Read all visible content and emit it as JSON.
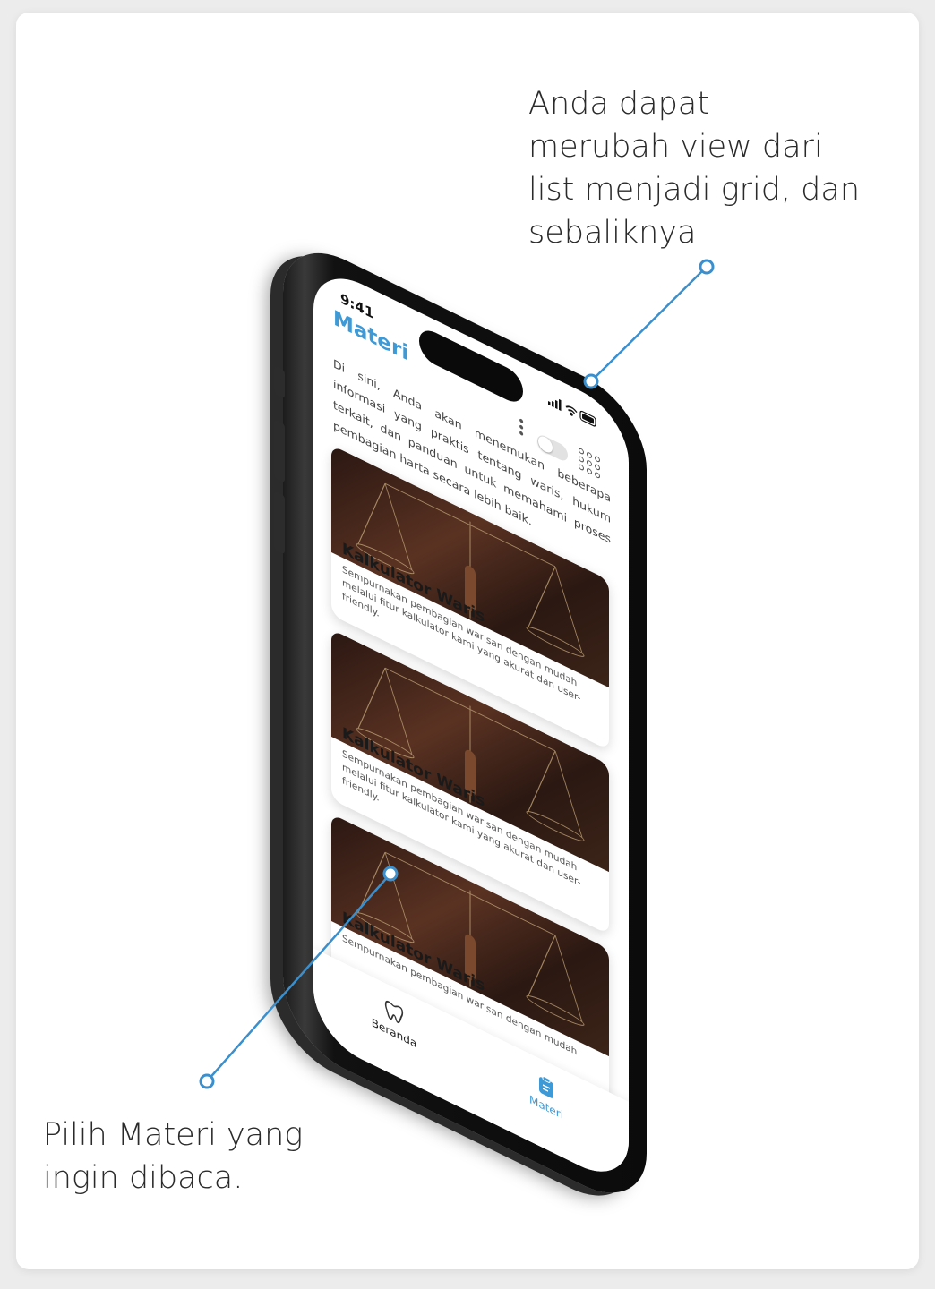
{
  "annotations": {
    "top": "Anda dapat\nmerubah view dari\nlist menjadi grid, dan\nsebaliknya",
    "bottom": "Pilih Materi yang\ningin dibaca."
  },
  "colors": {
    "accent": "#3d9ad6",
    "callout": "#3b8fcc"
  },
  "screen": {
    "status_time": "9:41",
    "status_icons": "signal-icon wifi-icon battery-icon",
    "title": "Materi",
    "description": "Di sini, Anda akan menemukan beberapa informasi yang praktis tentang waris, hukum terkait, dan panduan untuk memahami proses pembagian harta secara lebih baik.",
    "view_toggle": {
      "list_icon": "dots-vertical-icon",
      "grid_icon": "grid-dots-icon"
    },
    "cards": [
      {
        "title": "Kalkulator Waris",
        "text": "Sempurnakan pembagian warisan dengan mudah melalui fitur kalkulator kami yang akurat dan user-friendly."
      },
      {
        "title": "Kalkulator Waris",
        "text": "Sempurnakan pembagian warisan dengan mudah melalui fitur kalkulator kami yang akurat dan user-friendly."
      },
      {
        "title": "Kalkulator Waris",
        "text": "Sempurnakan pembagian warisan dengan mudah"
      }
    ],
    "nav": {
      "beranda": "Beranda",
      "materi": "Materi"
    }
  }
}
